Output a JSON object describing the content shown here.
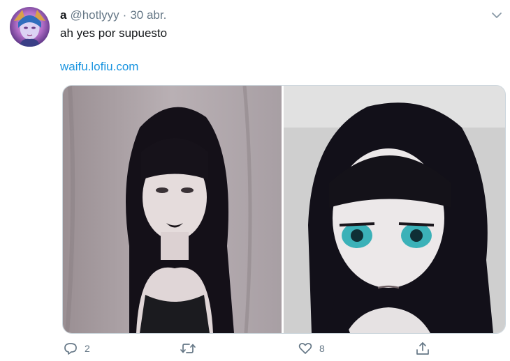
{
  "tweet": {
    "display_name": "a",
    "handle": "@hotlyyy",
    "separator": "·",
    "timestamp": "30 abr.",
    "text": "ah yes por supuesto",
    "link": "waifu.lofiu.com"
  },
  "actions": {
    "reply_count": "2",
    "retweet_count": "",
    "like_count": "8"
  },
  "icons": {
    "menu": "chevron-down-icon",
    "reply": "speech-bubble-icon",
    "retweet": "retweet-arrows-icon",
    "like": "heart-icon",
    "share": "share-upload-icon"
  },
  "colors": {
    "text": "#14171a",
    "secondary": "#657786",
    "link": "#1b95e0",
    "border": "#ccd6dd"
  }
}
